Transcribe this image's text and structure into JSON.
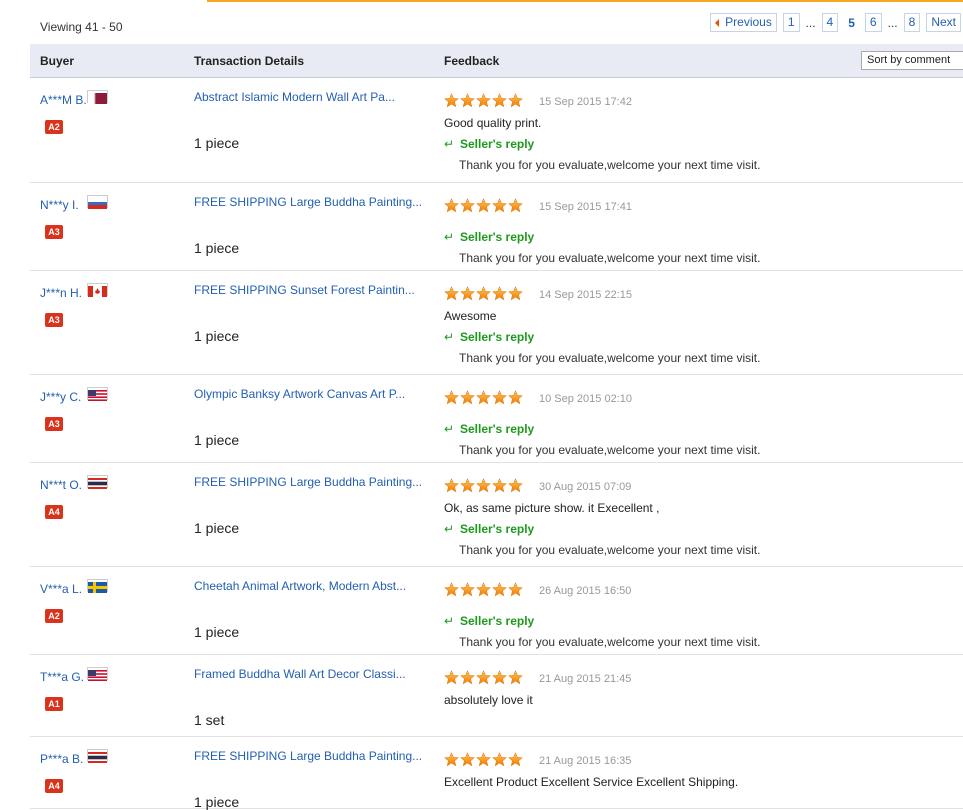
{
  "viewing": "Viewing 41 - 50",
  "pager": {
    "previous": "Previous",
    "pages": [
      "1",
      "...",
      "4",
      "5",
      "6",
      "...",
      "8"
    ],
    "current": "5",
    "next": "Next"
  },
  "table": {
    "headers": {
      "buyer": "Buyer",
      "details": "Transaction Details",
      "feedback": "Feedback"
    },
    "sort": "Sort by comment"
  },
  "seller_reply_label": "Seller's reply",
  "rows": [
    {
      "buyer": "A***M B.",
      "flag": "qatar",
      "badge": "A2",
      "title": "Abstract Islamic Modern Wall Art Pa...",
      "qty": "1 piece",
      "rating": 5,
      "date": "15 Sep 2015 17:42",
      "comment": "Good quality print.",
      "reply": "Thank you for you evaluate,welcome your next time visit."
    },
    {
      "buyer": "N***y I.",
      "flag": "russia",
      "badge": "A3",
      "title": "FREE SHIPPING Large Buddha Painting...",
      "qty": "1 piece",
      "rating": 5,
      "date": "15 Sep 2015 17:41",
      "comment": "",
      "reply": "Thank you for you evaluate,welcome your next time visit."
    },
    {
      "buyer": "J***n H.",
      "flag": "canada",
      "badge": "A3",
      "title": "FREE SHIPPING Sunset Forest Paintin...",
      "qty": "1 piece",
      "rating": 5,
      "date": "14 Sep 2015 22:15",
      "comment": "Awesome",
      "reply": "Thank you for you evaluate,welcome your next time visit."
    },
    {
      "buyer": "J***y C.",
      "flag": "usa",
      "badge": "A3",
      "title": "Olympic Banksy Artwork Canvas Art P...",
      "qty": "1 piece",
      "rating": 5,
      "date": "10 Sep 2015 02:10",
      "comment": "",
      "reply": "Thank you for you evaluate,welcome your next time visit."
    },
    {
      "buyer": "N***t O.",
      "flag": "thailand",
      "badge": "A4",
      "title": "FREE SHIPPING Large Buddha Painting...",
      "qty": "1 piece",
      "rating": 5,
      "date": "30 Aug 2015 07:09",
      "comment": "Ok, as same picture show. it Execellent ,",
      "reply": "Thank you for you evaluate,welcome your next time visit."
    },
    {
      "buyer": "V***a L.",
      "flag": "sweden",
      "badge": "A2",
      "title": "Cheetah Animal Artwork, Modern Abst...",
      "qty": "1 piece",
      "rating": 5,
      "date": "26 Aug 2015 16:50",
      "comment": "",
      "reply": "Thank you for you evaluate,welcome your next time visit."
    },
    {
      "buyer": "T***a G.",
      "flag": "usa",
      "badge": "A1",
      "title": "Framed Buddha Wall Art Decor Classi...",
      "qty": "1 set",
      "rating": 5,
      "date": "21 Aug 2015 21:45",
      "comment": "absolutely love it",
      "reply": ""
    },
    {
      "buyer": "P***a B.",
      "flag": "thailand",
      "badge": "A4",
      "title": "FREE SHIPPING Large Buddha Painting...",
      "qty": "1 piece",
      "rating": 5,
      "date": "21 Aug 2015 16:35",
      "comment": "Excellent Product Excellent Service Excellent Shipping.",
      "reply": ""
    }
  ]
}
